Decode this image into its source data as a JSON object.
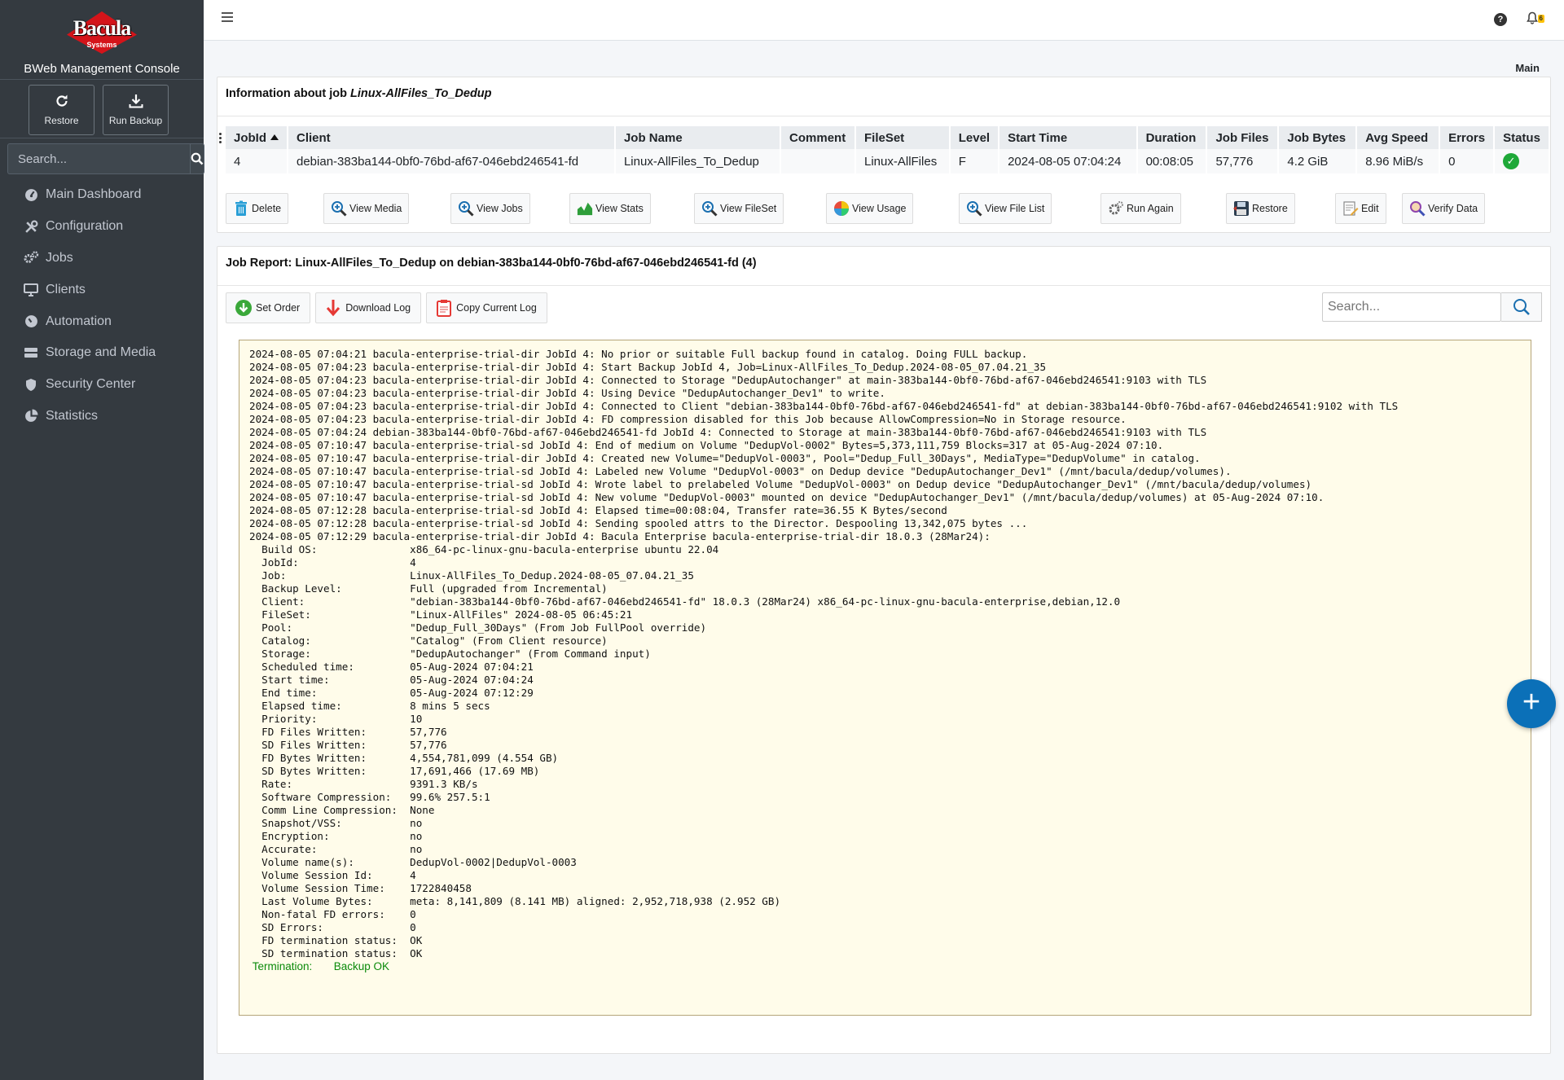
{
  "sidebar": {
    "brand": {
      "logo_text": "Bacula",
      "logo_sub": "Systems",
      "title": "BWeb Management Console"
    },
    "actions": [
      {
        "label": "Restore",
        "icon": "refresh-icon"
      },
      {
        "label": "Run Backup",
        "icon": "download-icon"
      }
    ],
    "search": {
      "placeholder": "Search..."
    },
    "nav": [
      {
        "label": "Main Dashboard",
        "icon": "dashboard-icon"
      },
      {
        "label": "Configuration",
        "icon": "tools-icon"
      },
      {
        "label": "Jobs",
        "icon": "cogs-icon"
      },
      {
        "label": "Clients",
        "icon": "desktop-icon"
      },
      {
        "label": "Automation",
        "icon": "gauge-icon"
      },
      {
        "label": "Storage and Media",
        "icon": "hdd-icon"
      },
      {
        "label": "Security Center",
        "icon": "shield-icon"
      },
      {
        "label": "Statistics",
        "icon": "pie-chart-icon"
      }
    ]
  },
  "topbar": {
    "help": "?",
    "notifications_count": "6"
  },
  "breadcrumb": "Main",
  "job_info": {
    "heading_prefix": "Information about job ",
    "job_name": "Linux-AllFiles_To_Dedup",
    "columns": [
      "JobId",
      "Client",
      "Job Name",
      "Comment",
      "FileSet",
      "Level",
      "Start Time",
      "Duration",
      "Job Files",
      "Job Bytes",
      "Avg Speed",
      "Errors",
      "Status"
    ],
    "row": {
      "jobid": "4",
      "client": "debian-383ba144-0bf0-76bd-af67-046ebd246541-fd",
      "job_name": "Linux-AllFiles_To_Dedup",
      "comment": "",
      "fileset": "Linux-AllFiles",
      "level": "F",
      "start_time": "2024-08-05 07:04:24",
      "duration": "00:08:05",
      "job_files": "57,776",
      "job_bytes": "4.2 GiB",
      "avg_speed": "8.96 MiB/s",
      "errors": "0",
      "status": "ok"
    },
    "buttons": [
      {
        "label": "Delete",
        "icon": "trash-icon"
      },
      {
        "label": "View Media",
        "icon": "zoom-icon"
      },
      {
        "label": "View Jobs",
        "icon": "zoom-icon"
      },
      {
        "label": "View Stats",
        "icon": "area-chart-icon"
      },
      {
        "label": "View FileSet",
        "icon": "zoom-icon"
      },
      {
        "label": "View Usage",
        "icon": "pie-icon"
      },
      {
        "label": "View File List",
        "icon": "zoom-icon"
      },
      {
        "label": "Run Again",
        "icon": "gears-icon"
      },
      {
        "label": "Restore",
        "icon": "floppy-icon"
      },
      {
        "label": "Edit",
        "icon": "edit-icon"
      },
      {
        "label": "Verify Data",
        "icon": "magnifier-icon"
      }
    ]
  },
  "job_report": {
    "heading": "Job Report: Linux-AllFiles_To_Dedup on debian-383ba144-0bf0-76bd-af67-046ebd246541-fd (4)",
    "tools": [
      {
        "label": "Set Order",
        "icon": "arrow-down-circle-icon"
      },
      {
        "label": "Download Log",
        "icon": "arrow-down-icon"
      },
      {
        "label": "Copy Current Log",
        "icon": "clipboard-icon"
      }
    ],
    "search": {
      "placeholder": "Search..."
    },
    "log_lines": [
      "2024-08-05 07:04:21 bacula-enterprise-trial-dir JobId 4: No prior or suitable Full backup found in catalog. Doing FULL backup.",
      "2024-08-05 07:04:23 bacula-enterprise-trial-dir JobId 4: Start Backup JobId 4, Job=Linux-AllFiles_To_Dedup.2024-08-05_07.04.21_35",
      "2024-08-05 07:04:23 bacula-enterprise-trial-dir JobId 4: Connected to Storage \"DedupAutochanger\" at main-383ba144-0bf0-76bd-af67-046ebd246541:9103 with TLS",
      "2024-08-05 07:04:23 bacula-enterprise-trial-dir JobId 4: Using Device \"DedupAutochanger_Dev1\" to write.",
      "2024-08-05 07:04:23 bacula-enterprise-trial-dir JobId 4: Connected to Client \"debian-383ba144-0bf0-76bd-af67-046ebd246541-fd\" at debian-383ba144-0bf0-76bd-af67-046ebd246541:9102 with TLS",
      "2024-08-05 07:04:23 bacula-enterprise-trial-dir JobId 4: FD compression disabled for this Job because AllowCompression=No in Storage resource.",
      "2024-08-05 07:04:24 debian-383ba144-0bf0-76bd-af67-046ebd246541-fd JobId 4: Connected to Storage at main-383ba144-0bf0-76bd-af67-046ebd246541:9103 with TLS",
      "2024-08-05 07:10:47 bacula-enterprise-trial-sd JobId 4: End of medium on Volume \"DedupVol-0002\" Bytes=5,373,111,759 Blocks=317 at 05-Aug-2024 07:10.",
      "2024-08-05 07:10:47 bacula-enterprise-trial-dir JobId 4: Created new Volume=\"DedupVol-0003\", Pool=\"Dedup_Full_30Days\", MediaType=\"DedupVolume\" in catalog.",
      "2024-08-05 07:10:47 bacula-enterprise-trial-sd JobId 4: Labeled new Volume \"DedupVol-0003\" on Dedup device \"DedupAutochanger_Dev1\" (/mnt/bacula/dedup/volumes).",
      "2024-08-05 07:10:47 bacula-enterprise-trial-sd JobId 4: Wrote label to prelabeled Volume \"DedupVol-0003\" on Dedup device \"DedupAutochanger_Dev1\" (/mnt/bacula/dedup/volumes)",
      "2024-08-05 07:10:47 bacula-enterprise-trial-sd JobId 4: New volume \"DedupVol-0003\" mounted on device \"DedupAutochanger_Dev1\" (/mnt/bacula/dedup/volumes) at 05-Aug-2024 07:10.",
      "2024-08-05 07:12:28 bacula-enterprise-trial-sd JobId 4: Elapsed time=00:08:04, Transfer rate=36.55 K Bytes/second",
      "2024-08-05 07:12:28 bacula-enterprise-trial-sd JobId 4: Sending spooled attrs to the Director. Despooling 13,342,075 bytes ...",
      "2024-08-05 07:12:29 bacula-enterprise-trial-dir JobId 4: Bacula Enterprise bacula-enterprise-trial-dir 18.0.3 (28Mar24):",
      "  Build OS:               x86_64-pc-linux-gnu-bacula-enterprise ubuntu 22.04",
      "  JobId:                  4",
      "  Job:                    Linux-AllFiles_To_Dedup.2024-08-05_07.04.21_35",
      "  Backup Level:           Full (upgraded from Incremental)",
      "  Client:                 \"debian-383ba144-0bf0-76bd-af67-046ebd246541-fd\" 18.0.3 (28Mar24) x86_64-pc-linux-gnu-bacula-enterprise,debian,12.0",
      "  FileSet:                \"Linux-AllFiles\" 2024-08-05 06:45:21",
      "  Pool:                   \"Dedup_Full_30Days\" (From Job FullPool override)",
      "  Catalog:                \"Catalog\" (From Client resource)",
      "  Storage:                \"DedupAutochanger\" (From Command input)",
      "  Scheduled time:         05-Aug-2024 07:04:21",
      "  Start time:             05-Aug-2024 07:04:24",
      "  End time:               05-Aug-2024 07:12:29",
      "  Elapsed time:           8 mins 5 secs",
      "  Priority:               10",
      "  FD Files Written:       57,776",
      "  SD Files Written:       57,776",
      "  FD Bytes Written:       4,554,781,099 (4.554 GB)",
      "  SD Bytes Written:       17,691,466 (17.69 MB)",
      "  Rate:                   9391.3 KB/s",
      "  Software Compression:   99.6% 257.5:1",
      "  Comm Line Compression:  None",
      "  Snapshot/VSS:           no",
      "  Encryption:             no",
      "  Accurate:               no",
      "  Volume name(s):         DedupVol-0002|DedupVol-0003",
      "  Volume Session Id:      4",
      "  Volume Session Time:    1722840458",
      "  Last Volume Bytes:      meta: 8,141,809 (8.141 MB) aligned: 2,952,718,938 (2.952 GB)",
      "  Non-fatal FD errors:    0",
      "  SD Errors:              0",
      "  FD termination status:  OK",
      "  SD termination status:  OK"
    ],
    "termination_label": "Termination:",
    "termination_value": "Backup OK"
  },
  "fab": {
    "label": "+"
  },
  "colors": {
    "sidebar_bg": "#343a40",
    "accent": "#0b70b8",
    "ok_green": "#1ea838",
    "log_bg": "#fffcea",
    "brand_red": "#d4141a"
  }
}
